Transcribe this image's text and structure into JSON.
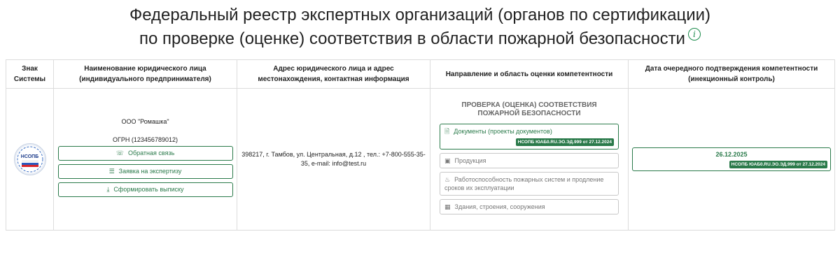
{
  "title": {
    "line1": "Федеральный реестр экспертных организаций (органов по сертификации)",
    "line2": "по проверке (оценке) соответствия в области пожарной безопасности",
    "info_icon": "i"
  },
  "table": {
    "headers": {
      "col1": "Знак Системы",
      "col2": "Наименование юридического лица (индивидуального предпринимателя)",
      "col3": "Адрес юридического лица и адрес местонахождения, контактная информация",
      "col4": "Направление и область оценки компетентности",
      "col5": "Дата очередного подтверждения компетентности (инекционный контроль)"
    },
    "row": {
      "logo_text": "НСОПБ",
      "org_name": "ООО \"Ромашка\"",
      "ogrn": "ОГРН (123456789012)",
      "buttons": {
        "feedback": "Обратная связь",
        "application": "Заявка на экспертизу",
        "extract": "Сформировать выписку"
      },
      "address": "398217, г. Тамбов, ул. Центральная, д.12 , тел.: +7-800-555-35-35, e-mail: info@test.ru",
      "direction_heading": "ПРОВЕРКА (ОЦЕНКА) СООТВЕТСТВИЯ ПОЖАРНОЙ БЕЗОПАСНОСТИ",
      "areas": [
        {
          "label": "Документы (проекты документов)",
          "badge": "НСОПБ ЮАБ0.RU.ЭО.ЭД.999 от 27.12.2024"
        },
        {
          "label": "Продукция"
        },
        {
          "label": "Работоспособность пожарных систем и продление сроков их эксплуатации"
        },
        {
          "label": "Здания, строения, сооружения"
        }
      ],
      "next_date": "26.12.2025",
      "next_date_badge": "НСОПБ ЮАБ0.RU.ЭО.ЭД.999 от 27.12.2024"
    }
  },
  "colors": {
    "accent": "#2a7a4a",
    "border": "#dcdcdc",
    "muted": "#777777"
  }
}
